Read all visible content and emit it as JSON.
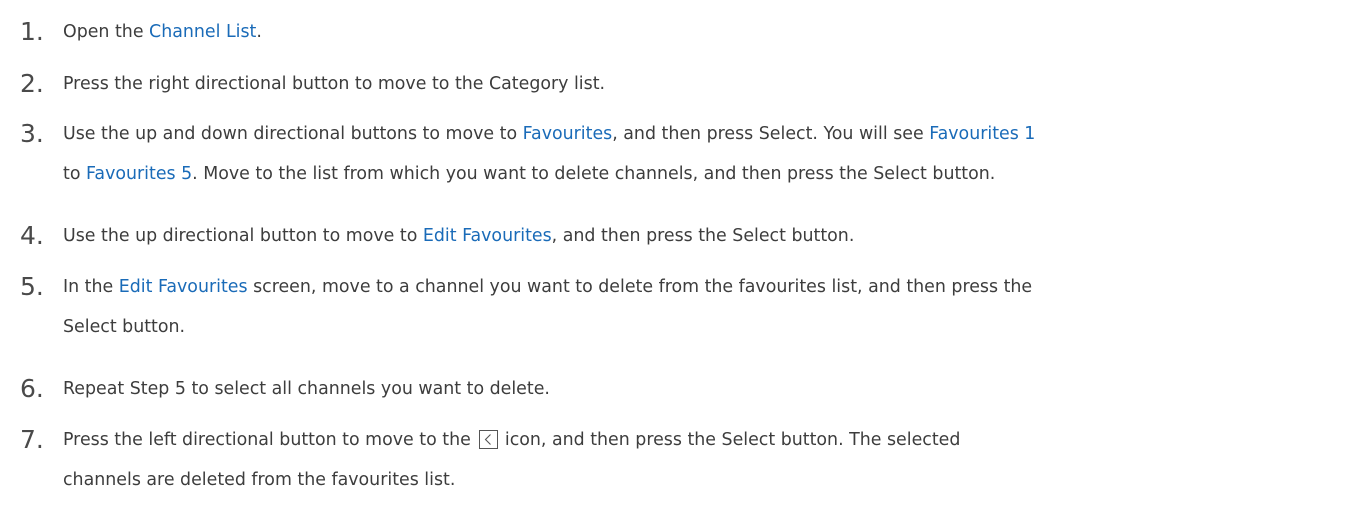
{
  "steps": [
    {
      "number": "1.",
      "lines": [
        [
          "Open the ",
          {
            "hl": "Channel List"
          },
          "."
        ]
      ]
    },
    {
      "number": "2.",
      "lines": [
        [
          "Press the right directional button to move to the Category list."
        ]
      ]
    },
    {
      "number": "3.",
      "lines": [
        [
          "Use the up and down directional buttons to move to ",
          {
            "hl": "Favourites"
          },
          ", and then press Select. You will see ",
          {
            "hl": "Favourites 1"
          }
        ],
        [
          "to ",
          {
            "hl": "Favourites 5"
          },
          ". Move to the list from which you want to delete channels, and then press the Select button."
        ]
      ]
    },
    {
      "number": "4.",
      "lines": [
        [
          "Use the up directional button to move to ",
          {
            "hl": "Edit Favourites"
          },
          ", and then press the Select button."
        ]
      ]
    },
    {
      "number": "5.",
      "lines": [
        [
          "In the ",
          {
            "hl": "Edit Favourites"
          },
          " screen, move to a channel you want to delete from the favourites list, and then press the"
        ],
        [
          "Select button."
        ]
      ]
    },
    {
      "number": "6.",
      "lines": [
        [
          "Repeat Step 5 to select all channels you want to delete."
        ]
      ]
    },
    {
      "number": "7.",
      "lines": [
        [
          "Press the left directional button to move to the ",
          {
            "icon": "chevron-left-icon"
          },
          " icon, and then press the Select button. The selected"
        ],
        [
          "channels are deleted from the favourites list."
        ]
      ]
    }
  ],
  "colors": {
    "text": "#3d3d3d",
    "highlight": "#1a6bb8",
    "number": "#4a4a4a"
  }
}
